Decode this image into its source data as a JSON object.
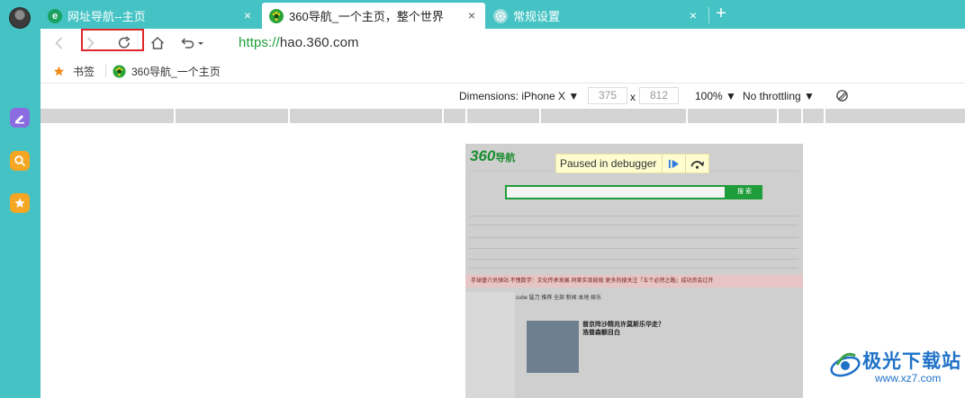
{
  "tabs": [
    {
      "title": "网址导航--主页",
      "icon": "360-e-icon",
      "active": false
    },
    {
      "title": "360导航_一个主页，整个世界",
      "icon": "360-nav-icon",
      "active": true
    },
    {
      "title": "常规设置",
      "icon": "settings-gear-icon",
      "active": false
    }
  ],
  "toolbar": {
    "address_scheme": "https://",
    "address_host": "hao.360.com"
  },
  "bookmarks": {
    "label": "书签",
    "items": [
      {
        "title": "360导航_一个主页"
      }
    ]
  },
  "device_toolbar": {
    "dimensions_label": "Dimensions: iPhone X",
    "width": "375",
    "times": "x",
    "height": "812",
    "zoom": "100%",
    "throttling": "No throttling"
  },
  "debugger": {
    "label": "Paused in debugger"
  },
  "phone_page": {
    "logo": "360",
    "logo_suffix": "导航",
    "search_button": "搜 索",
    "banner_text": "手球盛介员弹站    不愧数学：文化传承发展·同辈实现能级    更多热搜关注『五个必然之路』成功资会过开",
    "cube_label": "cube  猛刀    推荐   全部   新闻   本地   娱乐",
    "news_headline": "普京阵沙精兆许莫斯乐华走？\n浩普森额目白"
  },
  "watermark": {
    "brand": "极光下载站",
    "url": "www.xz7.com"
  },
  "colors": {
    "accent": "#45c3c4",
    "highlight_box": "#e0262b",
    "url_scheme": "#1e9e3a",
    "debugger_bg": "#fffdd0",
    "watermark": "#1f72c8"
  }
}
